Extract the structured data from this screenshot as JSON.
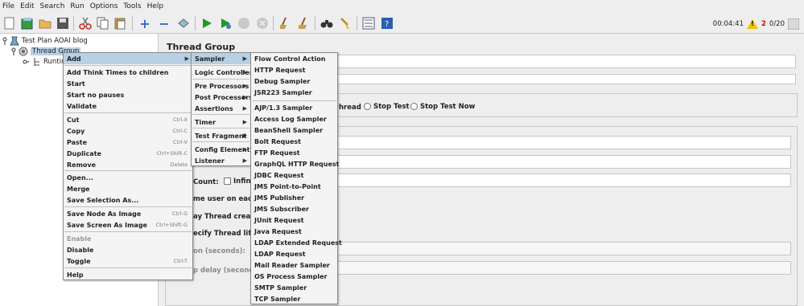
{
  "menubar": [
    "File",
    "Edit",
    "Search",
    "Run",
    "Options",
    "Tools",
    "Help"
  ],
  "status": {
    "elapsed": "00:04:41",
    "warnings": "2",
    "threads": "0/20"
  },
  "tree": {
    "root": "Test Plan AOAI blog",
    "group": "Thread Group",
    "child": "Runtim"
  },
  "main": {
    "title": "Thread Group",
    "after_error_partial": "hread",
    "stop_test": "Stop Test",
    "stop_test_now": "Stop Test Now",
    "loop_count": "Count:",
    "infinite": "Infinit",
    "same_user": "me user on each ite",
    "delay_creation": "ay Thread creation",
    "specify_lifetime": "ecify Thread lifetim",
    "duration": "on (seconds):",
    "startup_delay": "p delay (seconds):"
  },
  "context_menu": {
    "items": [
      {
        "label": "Add",
        "submenu": true,
        "highlighted": true
      },
      {
        "label": "Add Think Times to children"
      },
      {
        "label": "Start"
      },
      {
        "label": "Start no pauses"
      },
      {
        "label": "Validate"
      },
      {
        "label": "Cut",
        "shortcut": "Ctrl-X"
      },
      {
        "label": "Copy",
        "shortcut": "Ctrl-C"
      },
      {
        "label": "Paste",
        "shortcut": "Ctrl-V"
      },
      {
        "label": "Duplicate",
        "shortcut": "Ctrl+Shift-C"
      },
      {
        "label": "Remove",
        "shortcut": "Delete"
      },
      {
        "label": "Open..."
      },
      {
        "label": "Merge"
      },
      {
        "label": "Save Selection As..."
      },
      {
        "label": "Save Node As Image",
        "shortcut": "Ctrl-G"
      },
      {
        "label": "Save Screen As Image",
        "shortcut": "Ctrl+Shift-G"
      },
      {
        "label": "Enable",
        "disabled": true
      },
      {
        "label": "Disable"
      },
      {
        "label": "Toggle",
        "shortcut": "Ctrl-T"
      },
      {
        "label": "Help"
      }
    ]
  },
  "add_menu": {
    "items": [
      "Sampler",
      "Logic Controller",
      "Pre Processors",
      "Post Processors",
      "Assertions",
      "Timer",
      "Test Fragment",
      "Config Element",
      "Listener"
    ]
  },
  "sampler_menu": {
    "items": [
      "Flow Control Action",
      "HTTP Request",
      "Debug Sampler",
      "JSR223 Sampler",
      "AJP/1.3 Sampler",
      "Access Log Sampler",
      "BeanShell Sampler",
      "Bolt Request",
      "FTP Request",
      "GraphQL HTTP Request",
      "JDBC Request",
      "JMS Point-to-Point",
      "JMS Publisher",
      "JMS Subscriber",
      "JUnit Request",
      "Java Request",
      "LDAP Extended Request",
      "LDAP Request",
      "Mail Reader Sampler",
      "OS Process Sampler",
      "SMTP Sampler",
      "TCP Sampler"
    ]
  }
}
